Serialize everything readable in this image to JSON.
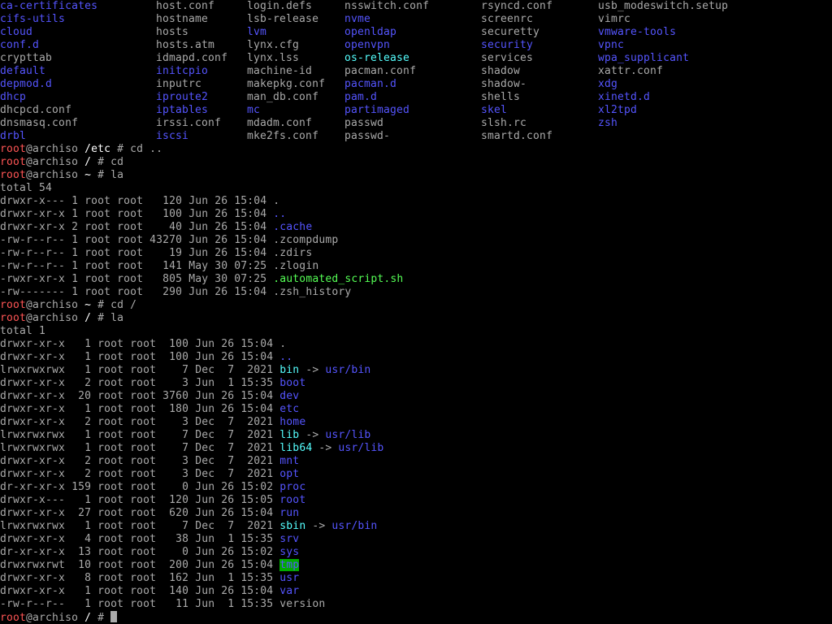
{
  "colors": {
    "background": "#000000",
    "text": "#aaaaaa",
    "directory": "#5555ff",
    "executable": "#55ff55",
    "symlink": "#55ffff",
    "root_user": "#ff5555",
    "sticky_bg": "#00aa00"
  },
  "etc_listing": [
    [
      {
        "t": "ca-certificates",
        "k": "dir"
      },
      {
        "t": "host.conf",
        "k": "file"
      },
      {
        "t": "login.defs",
        "k": "file"
      },
      {
        "t": "nsswitch.conf",
        "k": "file"
      },
      {
        "t": "rsyncd.conf",
        "k": "file"
      },
      {
        "t": "usb_modeswitch.setup",
        "k": "file"
      }
    ],
    [
      {
        "t": "cifs-utils",
        "k": "dir"
      },
      {
        "t": "hostname",
        "k": "file"
      },
      {
        "t": "lsb-release",
        "k": "file"
      },
      {
        "t": "nvme",
        "k": "dir"
      },
      {
        "t": "screenrc",
        "k": "file"
      },
      {
        "t": "vimrc",
        "k": "file"
      }
    ],
    [
      {
        "t": "cloud",
        "k": "dir"
      },
      {
        "t": "hosts",
        "k": "file"
      },
      {
        "t": "lvm",
        "k": "dir"
      },
      {
        "t": "openldap",
        "k": "dir"
      },
      {
        "t": "securetty",
        "k": "file"
      },
      {
        "t": "vmware-tools",
        "k": "dir"
      }
    ],
    [
      {
        "t": "conf.d",
        "k": "dir"
      },
      {
        "t": "hosts.atm",
        "k": "file"
      },
      {
        "t": "lynx.cfg",
        "k": "file"
      },
      {
        "t": "openvpn",
        "k": "dir"
      },
      {
        "t": "security",
        "k": "dir"
      },
      {
        "t": "vpnc",
        "k": "dir"
      }
    ],
    [
      {
        "t": "crypttab",
        "k": "file"
      },
      {
        "t": "idmapd.conf",
        "k": "file"
      },
      {
        "t": "lynx.lss",
        "k": "file"
      },
      {
        "t": "os-release",
        "k": "lnk"
      },
      {
        "t": "services",
        "k": "file"
      },
      {
        "t": "wpa_supplicant",
        "k": "dir"
      }
    ],
    [
      {
        "t": "default",
        "k": "dir"
      },
      {
        "t": "initcpio",
        "k": "dir"
      },
      {
        "t": "machine-id",
        "k": "file"
      },
      {
        "t": "pacman.conf",
        "k": "file"
      },
      {
        "t": "shadow",
        "k": "file"
      },
      {
        "t": "xattr.conf",
        "k": "file"
      }
    ],
    [
      {
        "t": "depmod.d",
        "k": "dir"
      },
      {
        "t": "inputrc",
        "k": "file"
      },
      {
        "t": "makepkg.conf",
        "k": "file"
      },
      {
        "t": "pacman.d",
        "k": "dir"
      },
      {
        "t": "shadow-",
        "k": "file"
      },
      {
        "t": "xdg",
        "k": "dir"
      }
    ],
    [
      {
        "t": "dhcp",
        "k": "dir"
      },
      {
        "t": "iproute2",
        "k": "dir"
      },
      {
        "t": "man_db.conf",
        "k": "file"
      },
      {
        "t": "pam.d",
        "k": "dir"
      },
      {
        "t": "shells",
        "k": "file"
      },
      {
        "t": "xinetd.d",
        "k": "dir"
      }
    ],
    [
      {
        "t": "dhcpcd.conf",
        "k": "file"
      },
      {
        "t": "iptables",
        "k": "dir"
      },
      {
        "t": "mc",
        "k": "dir"
      },
      {
        "t": "partimaged",
        "k": "dir"
      },
      {
        "t": "skel",
        "k": "dir"
      },
      {
        "t": "xl2tpd",
        "k": "dir"
      }
    ],
    [
      {
        "t": "dnsmasq.conf",
        "k": "file"
      },
      {
        "t": "irssi.conf",
        "k": "file"
      },
      {
        "t": "mdadm.conf",
        "k": "file"
      },
      {
        "t": "passwd",
        "k": "file"
      },
      {
        "t": "slsh.rc",
        "k": "file"
      },
      {
        "t": "zsh",
        "k": "dir"
      }
    ],
    [
      {
        "t": "drbl",
        "k": "dir"
      },
      {
        "t": "iscsi",
        "k": "dir"
      },
      {
        "t": "mke2fs.conf",
        "k": "file"
      },
      {
        "t": "passwd-",
        "k": "file"
      },
      {
        "t": "smartd.conf",
        "k": "file"
      },
      {
        "t": "",
        "k": "file"
      }
    ]
  ],
  "prompts": {
    "user": "root",
    "host_suffix": "@archiso",
    "p1_path": "/etc",
    "p1_cmd": " # cd ..",
    "p2_path": "/",
    "p2_cmd": " # cd",
    "p3_path": "~",
    "p3_cmd": " # la",
    "p4_path": "~",
    "p4_cmd": " # cd /",
    "p5_path": "/",
    "p5_cmd": " # la",
    "p6_path": "/",
    "p6_cmd": " # "
  },
  "home_listing": {
    "total": "total 54",
    "rows": [
      {
        "meta": "drwxr-x--- 1 root root   120 Jun 26 15:04 ",
        "name": ".",
        "k": "file"
      },
      {
        "meta": "drwxr-xr-x 1 root root   100 Jun 26 15:04 ",
        "name": "..",
        "k": "dir"
      },
      {
        "meta": "drwxr-xr-x 2 root root    40 Jun 26 15:04 ",
        "name": ".cache",
        "k": "dir"
      },
      {
        "meta": "-rw-r--r-- 1 root root 43270 Jun 26 15:04 ",
        "name": ".zcompdump",
        "k": "file"
      },
      {
        "meta": "-rw-r--r-- 1 root root    19 Jun 26 15:04 ",
        "name": ".zdirs",
        "k": "file"
      },
      {
        "meta": "-rw-r--r-- 1 root root   141 May 30 07:25 ",
        "name": ".zlogin",
        "k": "file"
      },
      {
        "meta": "-rwxr-xr-x 1 root root   805 May 30 07:25 ",
        "name": ".automated_script.sh",
        "k": "exe"
      },
      {
        "meta": "-rw------- 1 root root   290 Jun 26 15:04 ",
        "name": ".zsh_history",
        "k": "file"
      }
    ]
  },
  "root_listing": {
    "total": "total 1",
    "rows": [
      {
        "meta": "drwxr-xr-x   1 root root  100 Jun 26 15:04 ",
        "name": ".",
        "k": "file",
        "target": ""
      },
      {
        "meta": "drwxr-xr-x   1 root root  100 Jun 26 15:04 ",
        "name": "..",
        "k": "dir",
        "target": ""
      },
      {
        "meta": "lrwxrwxrwx   1 root root    7 Dec  7  2021 ",
        "name": "bin",
        "k": "lnk",
        "target": "usr/bin"
      },
      {
        "meta": "drwxr-xr-x   2 root root    3 Jun  1 15:35 ",
        "name": "boot",
        "k": "dir",
        "target": ""
      },
      {
        "meta": "drwxr-xr-x  20 root root 3760 Jun 26 15:04 ",
        "name": "dev",
        "k": "dir",
        "target": ""
      },
      {
        "meta": "drwxr-xr-x   1 root root  180 Jun 26 15:04 ",
        "name": "etc",
        "k": "dir",
        "target": ""
      },
      {
        "meta": "drwxr-xr-x   2 root root    3 Dec  7  2021 ",
        "name": "home",
        "k": "dir",
        "target": ""
      },
      {
        "meta": "lrwxrwxrwx   1 root root    7 Dec  7  2021 ",
        "name": "lib",
        "k": "lnk",
        "target": "usr/lib"
      },
      {
        "meta": "lrwxrwxrwx   1 root root    7 Dec  7  2021 ",
        "name": "lib64",
        "k": "lnk",
        "target": "usr/lib"
      },
      {
        "meta": "drwxr-xr-x   2 root root    3 Dec  7  2021 ",
        "name": "mnt",
        "k": "dir",
        "target": ""
      },
      {
        "meta": "drwxr-xr-x   2 root root    3 Dec  7  2021 ",
        "name": "opt",
        "k": "dir",
        "target": ""
      },
      {
        "meta": "dr-xr-xr-x 159 root root    0 Jun 26 15:02 ",
        "name": "proc",
        "k": "dir",
        "target": ""
      },
      {
        "meta": "drwxr-x---   1 root root  120 Jun 26 15:05 ",
        "name": "root",
        "k": "dir",
        "target": ""
      },
      {
        "meta": "drwxr-xr-x  27 root root  620 Jun 26 15:04 ",
        "name": "run",
        "k": "dir",
        "target": ""
      },
      {
        "meta": "lrwxrwxrwx   1 root root    7 Dec  7  2021 ",
        "name": "sbin",
        "k": "lnk",
        "target": "usr/bin"
      },
      {
        "meta": "drwxr-xr-x   4 root root   38 Jun  1 15:35 ",
        "name": "srv",
        "k": "dir",
        "target": ""
      },
      {
        "meta": "dr-xr-xr-x  13 root root    0 Jun 26 15:02 ",
        "name": "sys",
        "k": "dir",
        "target": ""
      },
      {
        "meta": "drwxrwxrwt  10 root root  200 Jun 26 15:04 ",
        "name": "tmp",
        "k": "sticky",
        "target": ""
      },
      {
        "meta": "drwxr-xr-x   8 root root  162 Jun  1 15:35 ",
        "name": "usr",
        "k": "dir",
        "target": ""
      },
      {
        "meta": "drwxr-xr-x   1 root root  140 Jun 26 15:04 ",
        "name": "var",
        "k": "dir",
        "target": ""
      },
      {
        "meta": "-rw-r--r--   1 root root   11 Jun  1 15:35 ",
        "name": "version",
        "k": "file",
        "target": ""
      }
    ]
  },
  "symlink_arrow": " -> "
}
